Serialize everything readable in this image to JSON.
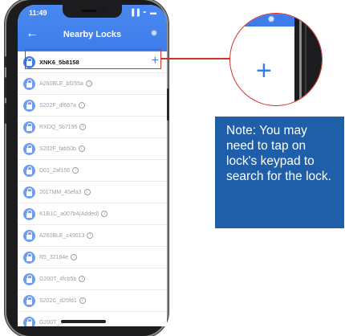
{
  "status_bar": {
    "time": "11:49",
    "icons": "▐▐ ◓ ▬"
  },
  "app_bar": {
    "back_icon": "arrow-left-icon",
    "title": "Nearby Locks",
    "spinner_icon": "loading-spinner-icon"
  },
  "locks": [
    {
      "name": "XNK6_5b8158",
      "info": false,
      "add": "+"
    },
    {
      "name": "A260BLE_bf255a",
      "info": true
    },
    {
      "name": "S202F_df667a",
      "info": true
    },
    {
      "name": "RXDQ_5b7195",
      "info": true
    },
    {
      "name": "S202F_fab50b",
      "info": true
    },
    {
      "name": "D01_2af156",
      "info": true
    },
    {
      "name": "2017MM_45efa3",
      "info": true
    },
    {
      "name": "K1B1C_a007b4(Added)",
      "info": true
    },
    {
      "name": "A260BLE_c49013",
      "info": true
    },
    {
      "name": "R5_32164e",
      "info": true
    },
    {
      "name": "G200T_4fcb5b",
      "info": true
    },
    {
      "name": "S202C_d25fd1",
      "info": true
    },
    {
      "name": "G200T_...",
      "info": false
    }
  ],
  "info_glyph": "i",
  "zoom": {
    "plus": "+"
  },
  "note": {
    "text": "Note: You may need to tap on lock's keypad to search for the lock."
  },
  "colors": {
    "accent_blue": "#3e7cea",
    "highlight_red": "#d8312a",
    "note_bg": "#1f5ea8"
  }
}
